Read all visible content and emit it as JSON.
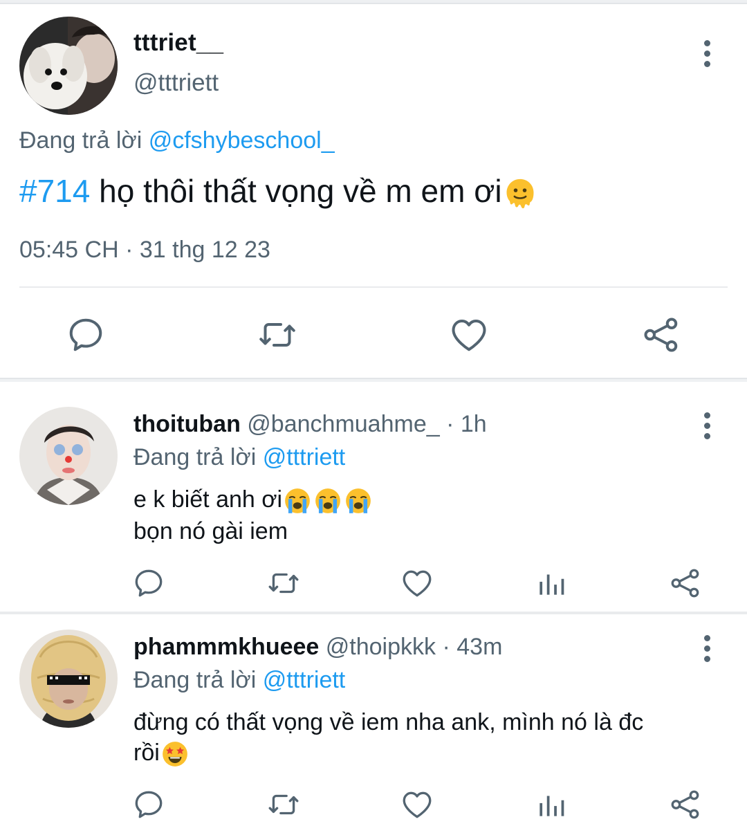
{
  "main_tweet": {
    "display_name": "tttriet__",
    "handle": "@tttriett",
    "replying_prefix": "Đang trả lời",
    "replying_to": "@cfshybeschool_",
    "hashtag": "#714",
    "text": "họ thôi thất vọng về m em ơi",
    "emoji": "melting-face",
    "time": "05:45 CH",
    "separator": "·",
    "date": "31 thg 12 23",
    "actions": [
      "reply-icon",
      "retweet-icon",
      "like-icon",
      "share-icon"
    ]
  },
  "replies": [
    {
      "display_name": "thoituban",
      "handle": "@banchmuahme_",
      "separator": "·",
      "time": "1h",
      "replying_prefix": "Đang trả lời",
      "replying_to": "@tttriett",
      "line1": "e k biết anh ơi",
      "line1_emoji": [
        "loudly-crying-face",
        "loudly-crying-face",
        "loudly-crying-face"
      ],
      "line2": "bọn nó gài iem",
      "actions": [
        "reply-icon",
        "retweet-icon",
        "like-icon",
        "analytics-icon",
        "share-icon"
      ]
    },
    {
      "display_name": "phammmkhueee",
      "handle": "@thoipkkk",
      "separator": "·",
      "time": "43m",
      "replying_prefix": "Đang trả lời",
      "replying_to": "@tttriett",
      "line1": "đừng có thất vọng về iem nha ank, mình nó là đc",
      "line2": "rồi",
      "line2_emoji": [
        "star-struck-face"
      ],
      "actions": [
        "reply-icon",
        "retweet-icon",
        "like-icon",
        "analytics-icon",
        "share-icon"
      ]
    }
  ],
  "colors": {
    "link": "#1d9bf0",
    "secondary_text": "#536471",
    "primary_text": "#0f1419",
    "icon": "#536471"
  }
}
